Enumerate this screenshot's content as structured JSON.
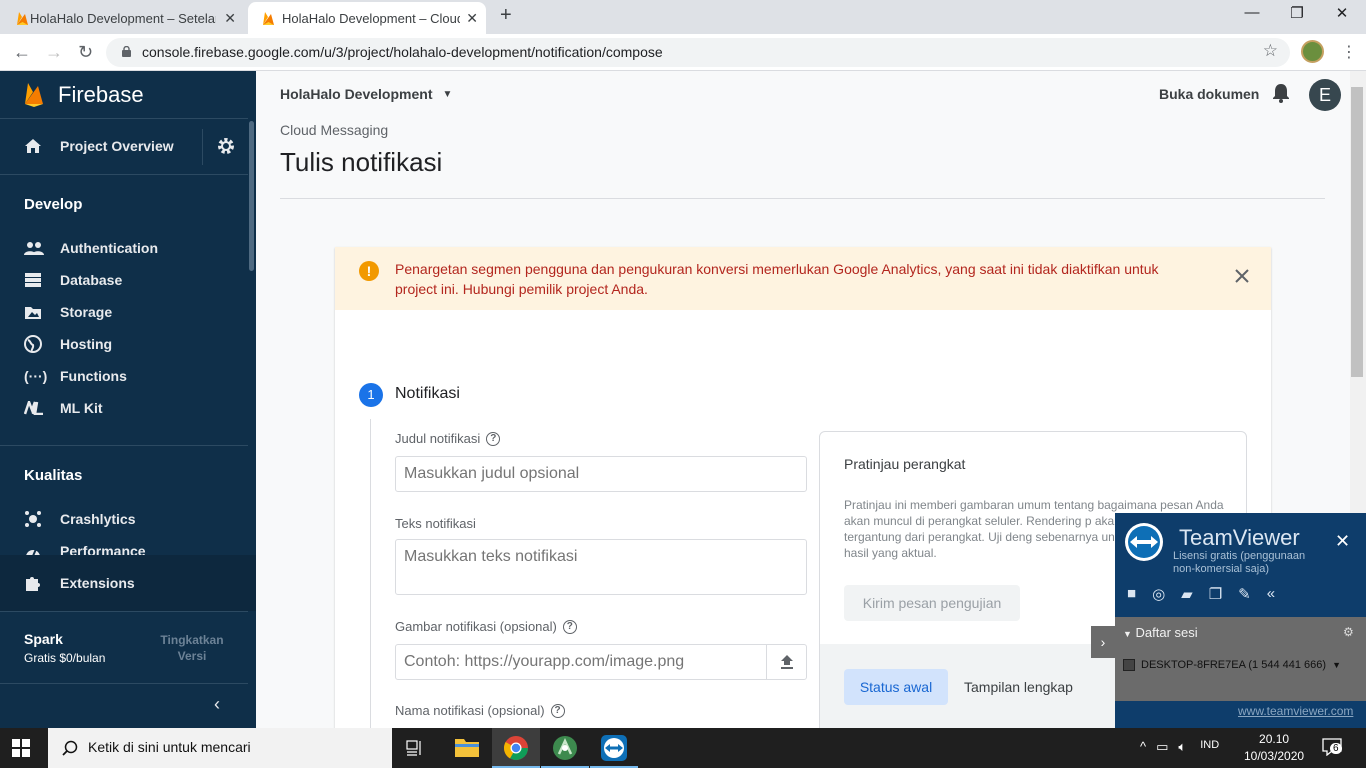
{
  "browser": {
    "tabs": [
      {
        "label": "HolaHalo Development – Setelan",
        "active": false
      },
      {
        "label": "HolaHalo Development – Cloud M",
        "active": true
      }
    ],
    "new_tab": "+",
    "url": "console.firebase.google.com/u/3/project/holahalo-development/notification/compose"
  },
  "sidebar": {
    "brand": "Firebase",
    "project_overview": "Project Overview",
    "develop_title": "Develop",
    "develop_items": [
      "Authentication",
      "Database",
      "Storage",
      "Hosting",
      "Functions",
      "ML Kit"
    ],
    "quality_title": "Kualitas",
    "quality_items": [
      "Crashlytics",
      "Performance"
    ],
    "extensions": "Extensions",
    "plan_name": "Spark",
    "plan_price": "Gratis $0/bulan",
    "upgrade": "Tingkatkan Versi"
  },
  "header": {
    "project": "HolaHalo Development",
    "docs": "Buka dokumen",
    "avatar_letter": "E"
  },
  "page": {
    "breadcrumb": "Cloud Messaging",
    "title": "Tulis notifikasi"
  },
  "banner": {
    "message": "Penargetan segmen pengguna dan pengukuran konversi memerlukan Google Analytics, yang saat ini tidak diaktifkan untuk project ini. Hubungi pemilik project Anda."
  },
  "form": {
    "step_number": "1",
    "step_title": "Notifikasi",
    "title_label": "Judul notifikasi",
    "title_placeholder": "Masukkan judul opsional",
    "text_label": "Teks notifikasi",
    "text_placeholder": "Masukkan teks notifikasi",
    "image_label": "Gambar notifikasi (opsional)",
    "image_placeholder": "Contoh: https://yourapp.com/image.png",
    "name_label": "Nama notifikasi (opsional)"
  },
  "preview": {
    "title": "Pratinjau perangkat",
    "description": "Pratinjau ini memberi gambaran umum tentang bagaimana pesan Anda akan muncul di perangkat seluler. Rendering p akan bervariasi, tergantung dari perangkat. Uji deng sebenarnya untuk mendapatkan hasil yang aktual.",
    "send_test": "Kirim pesan pengujian",
    "tab_initial": "Status awal",
    "tab_full": "Tampilan lengkap"
  },
  "teamviewer": {
    "name": "TeamViewer",
    "license": "Lisensi gratis (penggunaan non-komersial saja)",
    "sessions_title": "Daftar sesi",
    "session": "DESKTOP-8FRE7EA (1 544 441 666)",
    "link": "www.teamviewer.com"
  },
  "taskbar": {
    "search_placeholder": "Ketik di sini untuk mencari",
    "language": "IND",
    "time": "20.10",
    "date": "10/03/2020",
    "notification_count": "6"
  },
  "colors": {
    "sidebar_bg": "#0f2f49",
    "accent_blue": "#1a73e8",
    "warning_bg": "#fef3e0",
    "warning_text": "#b3261e",
    "firebase_orange": "#ffa000"
  }
}
